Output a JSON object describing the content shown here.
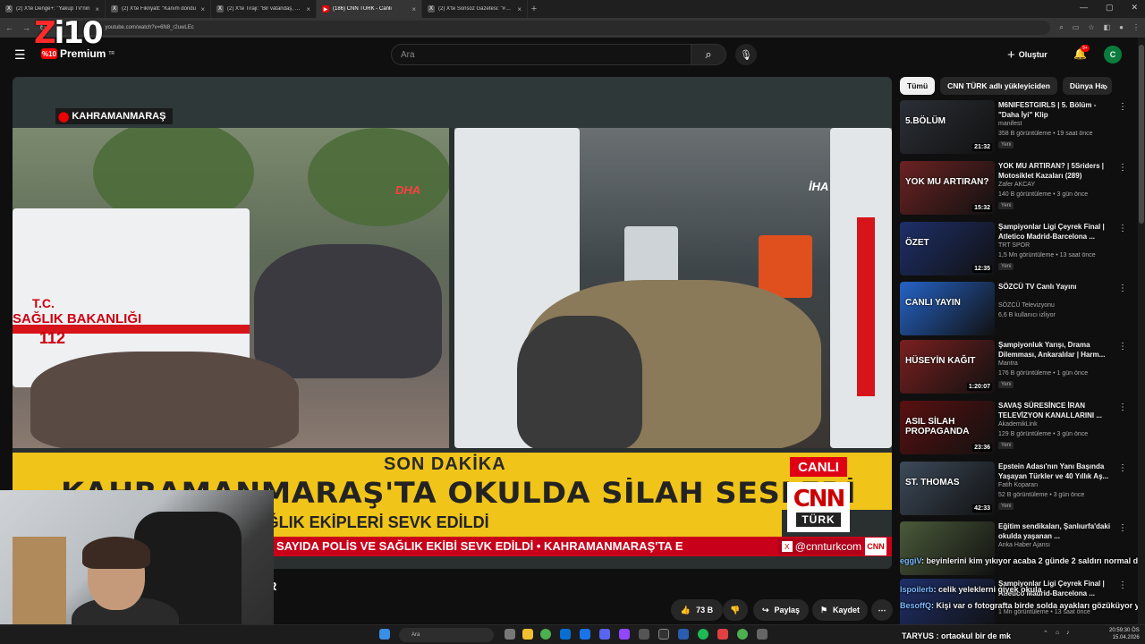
{
  "browser": {
    "tabs": [
      {
        "title": "(2) X'te Denge+: \"Yakup TV'nin"
      },
      {
        "title": "(2) X'te Fikriyatt: \"Kanım dondu"
      },
      {
        "title": "(2) X'te Tiraji: \"Bir vatandaş, Hal"
      },
      {
        "title": "(186) CNN TÜRK - Canlı"
      },
      {
        "title": "(2) X'te Sonsöz Gazetesi: \"#SON"
      }
    ],
    "active_tab": 3,
    "url": "youtube.com/watch?v=6N8_r2uwLEc"
  },
  "overlay_logo": {
    "z": "Z",
    "rest": "i10",
    "badge": "%10"
  },
  "youtube": {
    "logo_label": "Premium",
    "logo_sup": "TR",
    "search_placeholder": "Ara",
    "create_label": "Oluştur",
    "notif_count": "9+",
    "avatar_letter": "C"
  },
  "video": {
    "location": "KAHRAMANMARAŞ",
    "watermark_left": "DHA",
    "watermark_right": "İHA",
    "ambulance_text1": "T.C.",
    "ambulance_text2": "SAĞLIK BAKANLIĞI",
    "ambulance_text3": "112",
    "banner_label": "SON DAKİKA",
    "live_label": "CANLI",
    "headline": "KAHRAMANMARAŞ'TA OKULDA SİLAH SESLERİ",
    "subheadline": "OKULU'NA POLİS VE SAĞLIK EKİPLERİ SEVK EDİLDİ",
    "ticker": "SAYIDA POLİS VE SAĞLIK EKİBİ SEVK EDİLDİ  •  KAHRAMANMARAŞ'TA E",
    "handle": "@cnnturkcom",
    "cnn_top": "CNN",
    "cnn_bottom": "TÜRK",
    "cnn_mini": "CNN"
  },
  "video_title_stub": "R",
  "actions": {
    "like_count": "73 B",
    "share_label": "Paylaş",
    "save_label": "Kaydet"
  },
  "filters": [
    "Tümü",
    "CNN TÜRK adlı yükleyiciden",
    "Dünya Ha"
  ],
  "recommendations": [
    {
      "title": "M6NIFESTGIRLS | 5. Bölüm - \"Daha İyi\" Klip",
      "channel": "manifest",
      "meta": "358 B görüntüleme • 19 saat önce",
      "badge": "Yeni",
      "duration": "21:32",
      "thumb_text": "5.BÖLÜM",
      "color": "#2b2f36"
    },
    {
      "title": "YOK MU ARTIRAN? | 5Sriders | Motosiklet Kazaları (289)",
      "channel": "Zafer AKCAY",
      "meta": "140 B görüntüleme • 3 gün önce",
      "badge": "Yeni",
      "duration": "15:32",
      "thumb_text": "YOK MU ARTIRAN?",
      "color": "#6b2222"
    },
    {
      "title": "Şampiyonlar Ligi Çeyrek Final | Atletico Madrid-Barcelona ...",
      "channel": "TRT SPOR",
      "meta": "1,5 Mn görüntüleme • 13 saat önce",
      "badge": "Yeni",
      "duration": "12:35",
      "thumb_text": "ÖZET",
      "color": "#1e2f6a"
    },
    {
      "title": "SÖZCÜ TV Canlı Yayını",
      "channel": "SÖZCÜ Televizyonu",
      "meta": "6,6 B kullanıcı izliyor",
      "badge": "",
      "duration": "",
      "thumb_text": "CANLI YAYIN",
      "color": "#2563c7"
    },
    {
      "title": "Şampiyonluk Yarışı, Drama Dilemması, Ankaralılar | Harm...",
      "channel": "Mantra",
      "meta": "176 B görüntüleme • 1 gün önce",
      "badge": "Yeni",
      "duration": "1:20:07",
      "thumb_text": "HÜSEYİN KAĞIT",
      "color": "#7a1f1f"
    },
    {
      "title": "SAVAŞ SÜRESİNCE İRAN TELEVİZYON KANALLARINI ...",
      "channel": "AkademikLink",
      "meta": "129 B görüntüleme • 3 gün önce",
      "badge": "Yeni",
      "duration": "23:36",
      "thumb_text": "ASIL SİLAH PROPAGANDA",
      "color": "#5a1010"
    },
    {
      "title": "Epstein Adası'nın Yanı Başında Yaşayan Türkler ve 40 Yıllık Aş...",
      "channel": "Fatih Koparan",
      "meta": "52 B görüntüleme • 3 gün önce",
      "badge": "Yeni",
      "duration": "42:33",
      "thumb_text": "ST. THOMAS",
      "color": "#3d4a5a"
    },
    {
      "title": "Eğitim sendikaları, Şanlıurfa'daki okulda yaşanan ...",
      "channel": "Anka Haber Ajansı",
      "meta": "",
      "badge": "",
      "duration": "",
      "thumb_text": "",
      "color": "#4a5a3a"
    },
    {
      "title": "Şampiyonlar Ligi Çeyrek Final | Atletico Madrid-Barcelona ...",
      "channel": "",
      "meta": "1 Mn görüntüleme • 13 saat önce",
      "badge": "",
      "duration": "",
      "thumb_text": "",
      "color": "#1e2f6a"
    }
  ],
  "chat": [
    {
      "user": "eggiV",
      "msg": ": beyinlerini kim yıkıyor acaba 2 günde 2 saldırı normal değil gibi aq"
    },
    {
      "user": "lspoilerb",
      "msg": ": celik yeleklerni giyek okula"
    },
    {
      "user": "BesoffQ",
      "msg": ": Kişi var o fotografta birde solda ayakları gözüküyor yaralı"
    }
  ],
  "bottom_chat": "TARYUS : ortaokul bir de mk",
  "taskbar": {
    "search_placeholder": "Ara",
    "time": "20:59:30 ÖS",
    "date": "15.04.2026"
  }
}
